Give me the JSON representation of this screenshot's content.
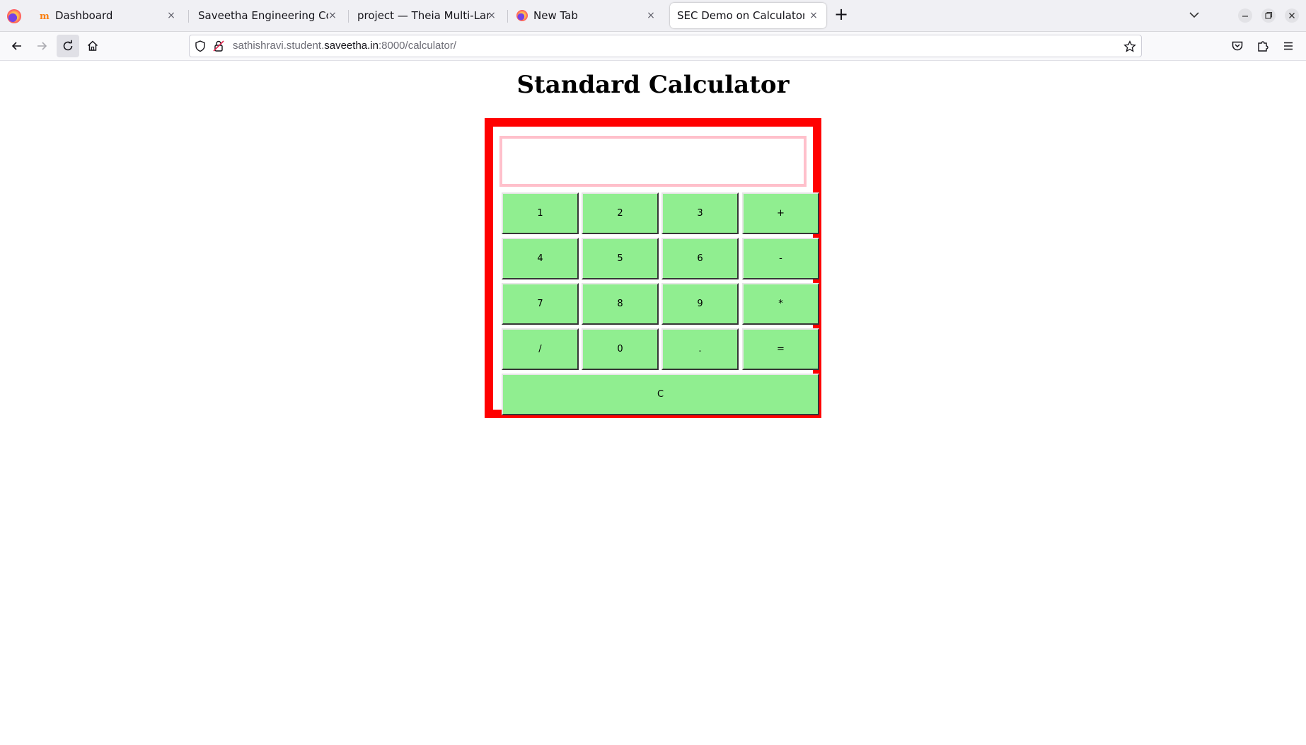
{
  "browser": {
    "tabs": [
      {
        "label": "Dashboard",
        "active": false,
        "favicon": "moodle-icon"
      },
      {
        "label": "Saveetha Engineering College",
        "active": false,
        "favicon": "none"
      },
      {
        "label": "project — Theia Multi-Language",
        "active": false,
        "favicon": "none"
      },
      {
        "label": "New Tab",
        "active": false,
        "favicon": "firefox-icon"
      },
      {
        "label": "SEC Demo on Calculator",
        "active": true,
        "favicon": "none"
      }
    ],
    "tab_close_glyph": "×",
    "new_tab_glyph": "+",
    "url": {
      "prefix": "sathishravi.student.",
      "domain": "saveetha.in",
      "suffix": ":8000/calculator/"
    }
  },
  "page": {
    "title": "Standard Calculator",
    "display_value": "",
    "keys": {
      "k1": "1",
      "k2": "2",
      "k3": "3",
      "plus": "+",
      "k4": "4",
      "k5": "5",
      "k6": "6",
      "minus": "-",
      "k7": "7",
      "k8": "8",
      "k9": "9",
      "multiply": "*",
      "divide": "/",
      "k0": "0",
      "dot": ".",
      "equals": "=",
      "clear": "C"
    },
    "colors": {
      "border": "#ff0000",
      "display_border": "#ffc0cb",
      "key_bg": "#90ee90"
    }
  }
}
